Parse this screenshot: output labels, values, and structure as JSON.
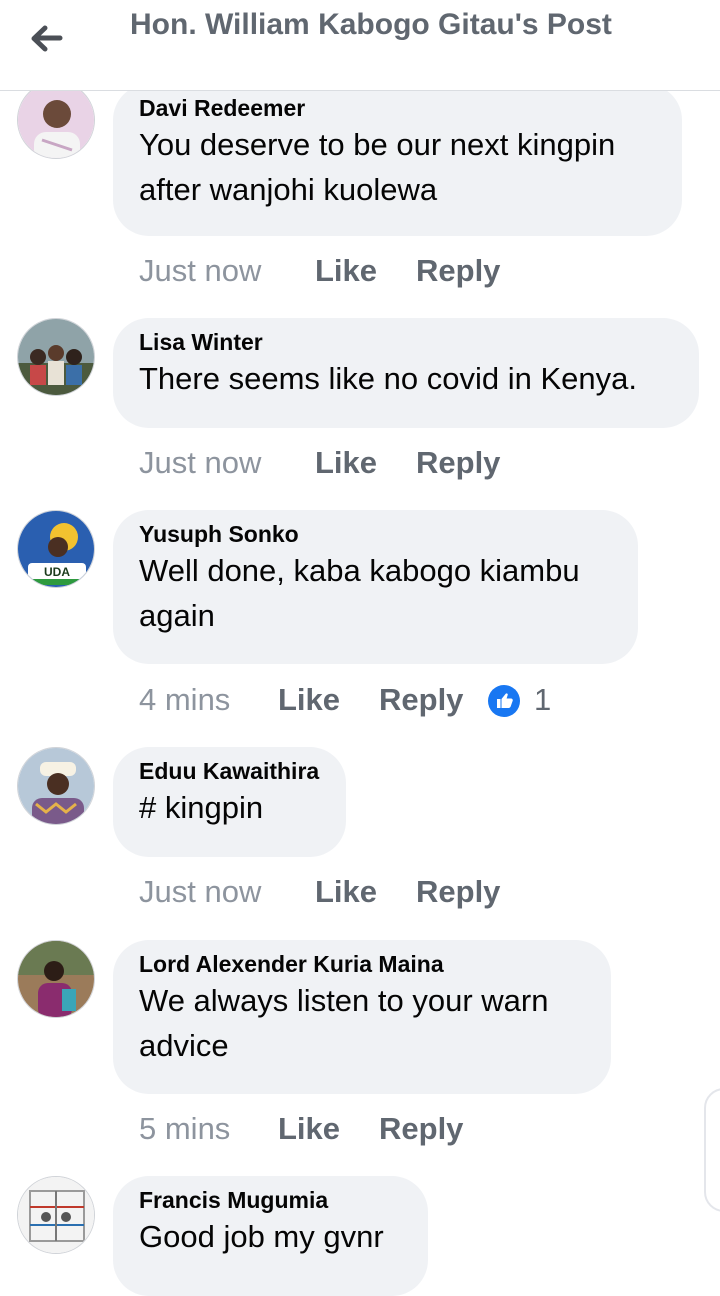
{
  "header": {
    "title": "Hon. William Kabogo Gitau's Post"
  },
  "comments": [
    {
      "author": "Davi Redeemer",
      "text": "You deserve to be our next kingpin after wanjohi kuolewa",
      "time": "Just now",
      "like": "Like",
      "reply": "Reply"
    },
    {
      "author": "Lisa Winter",
      "text": "There seems like no covid in Kenya.",
      "time": "Just now",
      "like": "Like",
      "reply": "Reply"
    },
    {
      "author": "Yusuph Sonko",
      "text": "Well done, kaba kabogo kiambu again",
      "time": "4 mins",
      "like": "Like",
      "reply": "Reply",
      "reaction_count": "1",
      "avatar_label": "UDA"
    },
    {
      "author": "Eduu Kawaithira",
      "text": "# kingpin",
      "time": "Just now",
      "like": "Like",
      "reply": "Reply"
    },
    {
      "author": "Lord Alexender Kuria Maina",
      "text": "We always listen to your warn advice",
      "time": "5 mins",
      "like": "Like",
      "reply": "Reply"
    },
    {
      "author": "Francis Mugumia",
      "text": "Good job my gvnr"
    }
  ],
  "colors": {
    "bubble": "#f0f2f5",
    "like_blue": "#1877f2",
    "meta_gray": "#8d949e",
    "action_gray": "#606770"
  },
  "icons": {
    "back": "arrow-left-icon",
    "reaction": "thumbs-up-icon"
  }
}
